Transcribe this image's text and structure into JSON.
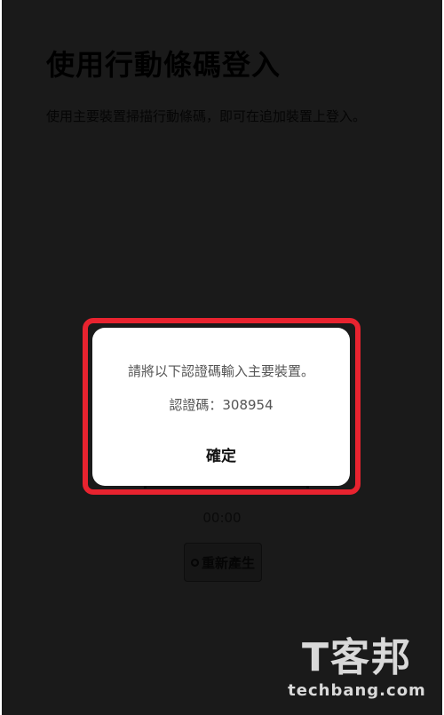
{
  "page": {
    "title": "使用行動條碼登入",
    "description": "使用主要裝置掃描行動條碼，即可在追加裝置上登入。",
    "timer": "00:00",
    "refresh_label": "重新產生"
  },
  "dialog": {
    "message": "請將以下認證碼輸入主要裝置。",
    "code": "認證碼：308954",
    "ok_label": "確定"
  },
  "watermark": {
    "logo": "T客邦",
    "url": "techbang.com"
  },
  "icons": {
    "refresh": "refresh-icon"
  },
  "colors": {
    "overlay": "#1a1a1a",
    "highlight": "#e8232f",
    "dialog_bg": "#ffffff"
  }
}
